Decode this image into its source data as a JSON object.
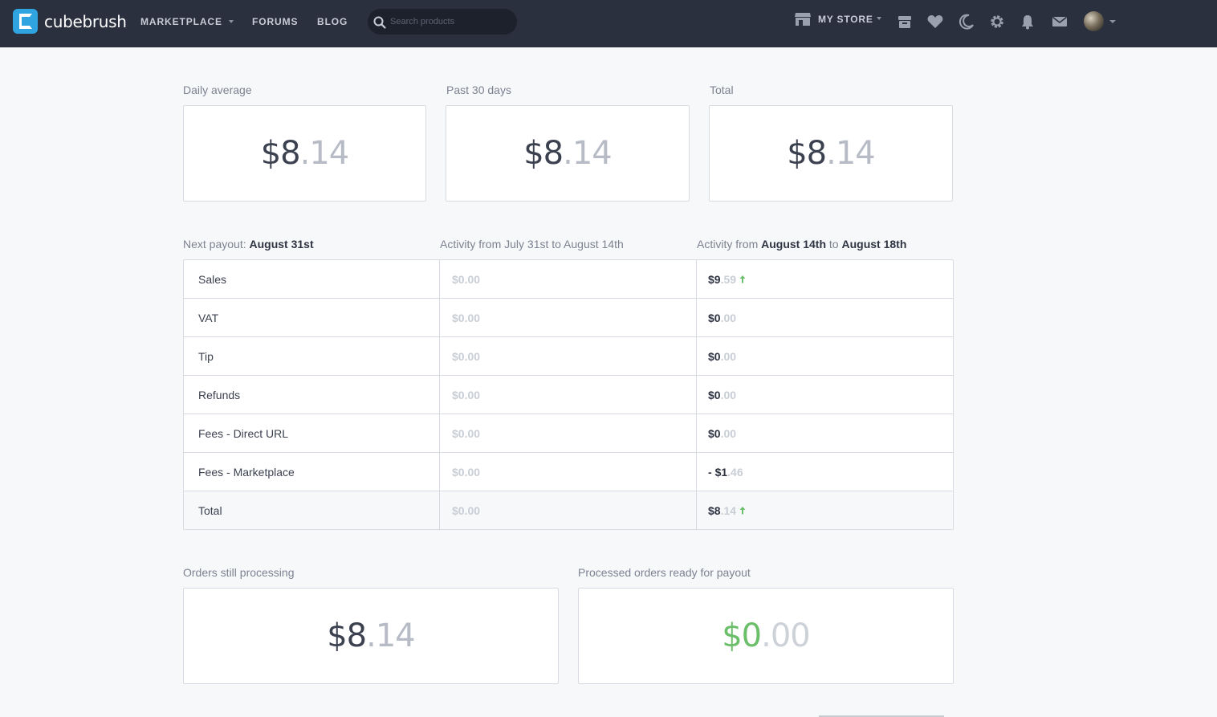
{
  "brand": {
    "name": "cubebrush",
    "accent": "#2fa4e0"
  },
  "nav": {
    "marketplace": "MARKETPLACE",
    "forums": "FORUMS",
    "blog": "BLOG",
    "search_placeholder": "Search products",
    "my_store": "MY STORE",
    "icons": [
      "store-icon",
      "archive-icon",
      "heart-icon",
      "moon-icon",
      "gear-icon",
      "bell-icon",
      "mail-icon"
    ]
  },
  "stats": {
    "daily_average": {
      "label": "Daily average",
      "dollars": "$8",
      "cents": ".14"
    },
    "past_30": {
      "label": "Past 30 days",
      "dollars": "$8",
      "cents": ".14"
    },
    "total": {
      "label": "Total",
      "dollars": "$8",
      "cents": ".14"
    }
  },
  "activity": {
    "col1": {
      "prefix": "Next payout:",
      "date": "August 31st"
    },
    "col2": {
      "text": "Activity from July 31st to August 14th"
    },
    "col3": {
      "prefix": "Activity from",
      "start": "August 14th",
      "mid": "to",
      "end": "August 18th"
    },
    "rows": [
      {
        "label": "Sales",
        "prev": "$0.00",
        "cur_prefix": "",
        "cur_dollars": "$9",
        "cur_cents": ".59",
        "trend": "up"
      },
      {
        "label": "VAT",
        "prev": "$0.00",
        "cur_prefix": "",
        "cur_dollars": "$0",
        "cur_cents": ".00"
      },
      {
        "label": "Tip",
        "prev": "$0.00",
        "cur_prefix": "",
        "cur_dollars": "$0",
        "cur_cents": ".00"
      },
      {
        "label": "Refunds",
        "prev": "$0.00",
        "cur_prefix": "",
        "cur_dollars": "$0",
        "cur_cents": ".00"
      },
      {
        "label": "Fees - Direct URL",
        "prev": "$0.00",
        "cur_prefix": "",
        "cur_dollars": "$0",
        "cur_cents": ".00"
      },
      {
        "label": "Fees - Marketplace",
        "prev": "$0.00",
        "cur_prefix": "- ",
        "cur_dollars": "$1",
        "cur_cents": ".46"
      },
      {
        "label": "Total",
        "prev": "$0.00",
        "cur_prefix": "",
        "cur_dollars": "$8",
        "cur_cents": ".14",
        "trend": "up"
      }
    ],
    "trend_color": "#6cbf6a"
  },
  "orders": {
    "processing": {
      "label": "Orders still processing",
      "dollars": "$8",
      "cents": ".14"
    },
    "ready": {
      "label": "Processed orders ready for payout",
      "dollars": "$0",
      "cents": ".00",
      "color": "#6cbf6a"
    }
  }
}
